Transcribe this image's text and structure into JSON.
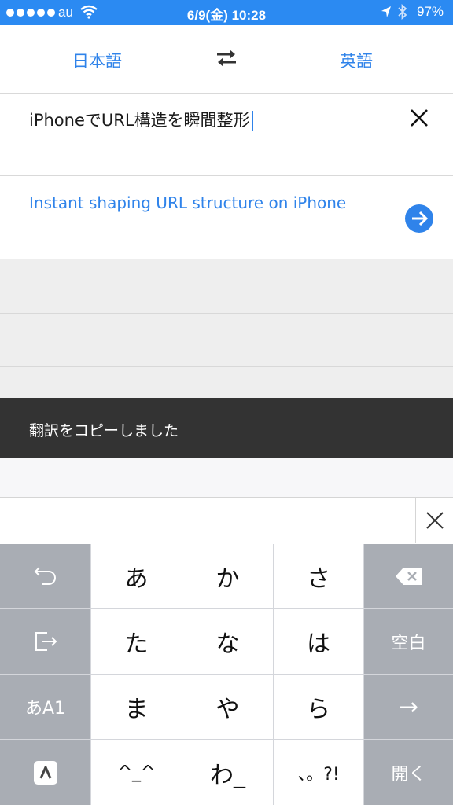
{
  "status_bar": {
    "carrier": "au",
    "time": "6/9(金) 10:28",
    "battery": "97%",
    "icons": [
      "signal-dots-icon",
      "wifi-icon",
      "location-arrow-icon",
      "bluetooth-icon",
      "battery-icon"
    ]
  },
  "languages": {
    "source": "日本語",
    "target": "英語",
    "swap_icon": "swap-arrows-icon"
  },
  "input": {
    "text": "iPhoneでURL構造を瞬間整形",
    "clear_icon": "close-icon"
  },
  "translation": {
    "text": "Instant shaping URL structure on iPhone",
    "go_icon": "arrow-right-circle-icon"
  },
  "toast": {
    "message": "翻訳をコピーしました"
  },
  "keyboard": {
    "rows": [
      [
        "undo-icon",
        "あ",
        "か",
        "さ",
        "delete-icon"
      ],
      [
        "next-field-icon",
        "た",
        "な",
        "は",
        "空白"
      ],
      [
        "あA1",
        "ま",
        "や",
        "ら",
        "→"
      ],
      [
        "app-icon",
        "^_^",
        "わ_",
        "、。?!",
        "開く"
      ]
    ]
  },
  "colors": {
    "accent": "#2f83ea",
    "status_bar": "#2b8af2",
    "toast_bg": "#333333",
    "keyboard_dark_key": "#a9adb4"
  }
}
